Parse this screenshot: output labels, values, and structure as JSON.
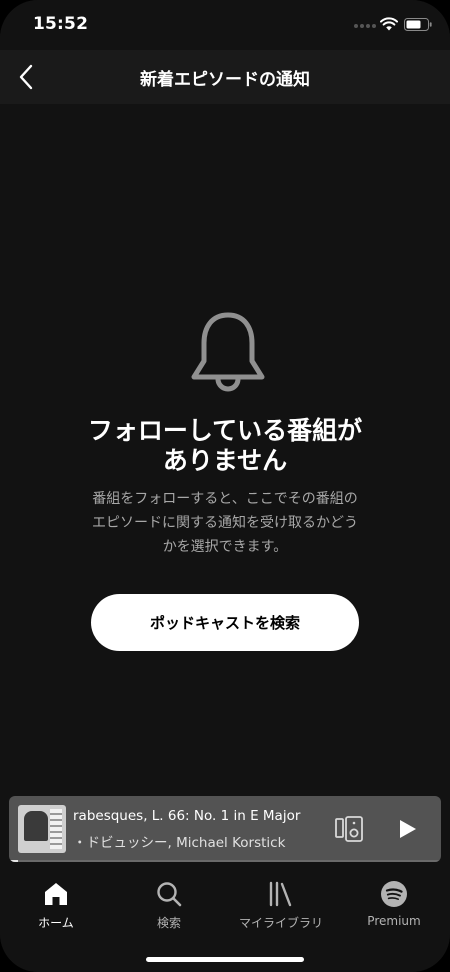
{
  "status_bar": {
    "time": "15:52"
  },
  "header": {
    "title": "新着エピソードの通知"
  },
  "empty_state": {
    "title_line1": "フォローしている番組が",
    "title_line2": "ありません",
    "description_line1": "番組をフォローすると、ここでその番組の",
    "description_line2": "エピソードに関する通知を受け取るかどう",
    "description_line3": "かを選択できます。",
    "button_label": "ポッドキャストを検索"
  },
  "mini_player": {
    "track_title": "rabesques, L. 66: No. 1 in E Major",
    "track_artist": "・ドビュッシー, Michael Korstick",
    "progress": 0.02
  },
  "nav": {
    "items": [
      {
        "label": "ホーム",
        "icon": "home-icon",
        "active": true
      },
      {
        "label": "検索",
        "icon": "search-icon",
        "active": false
      },
      {
        "label": "マイライブラリ",
        "icon": "library-icon",
        "active": false
      },
      {
        "label": "Premium",
        "icon": "spotify-logo-icon",
        "active": false
      }
    ]
  }
}
